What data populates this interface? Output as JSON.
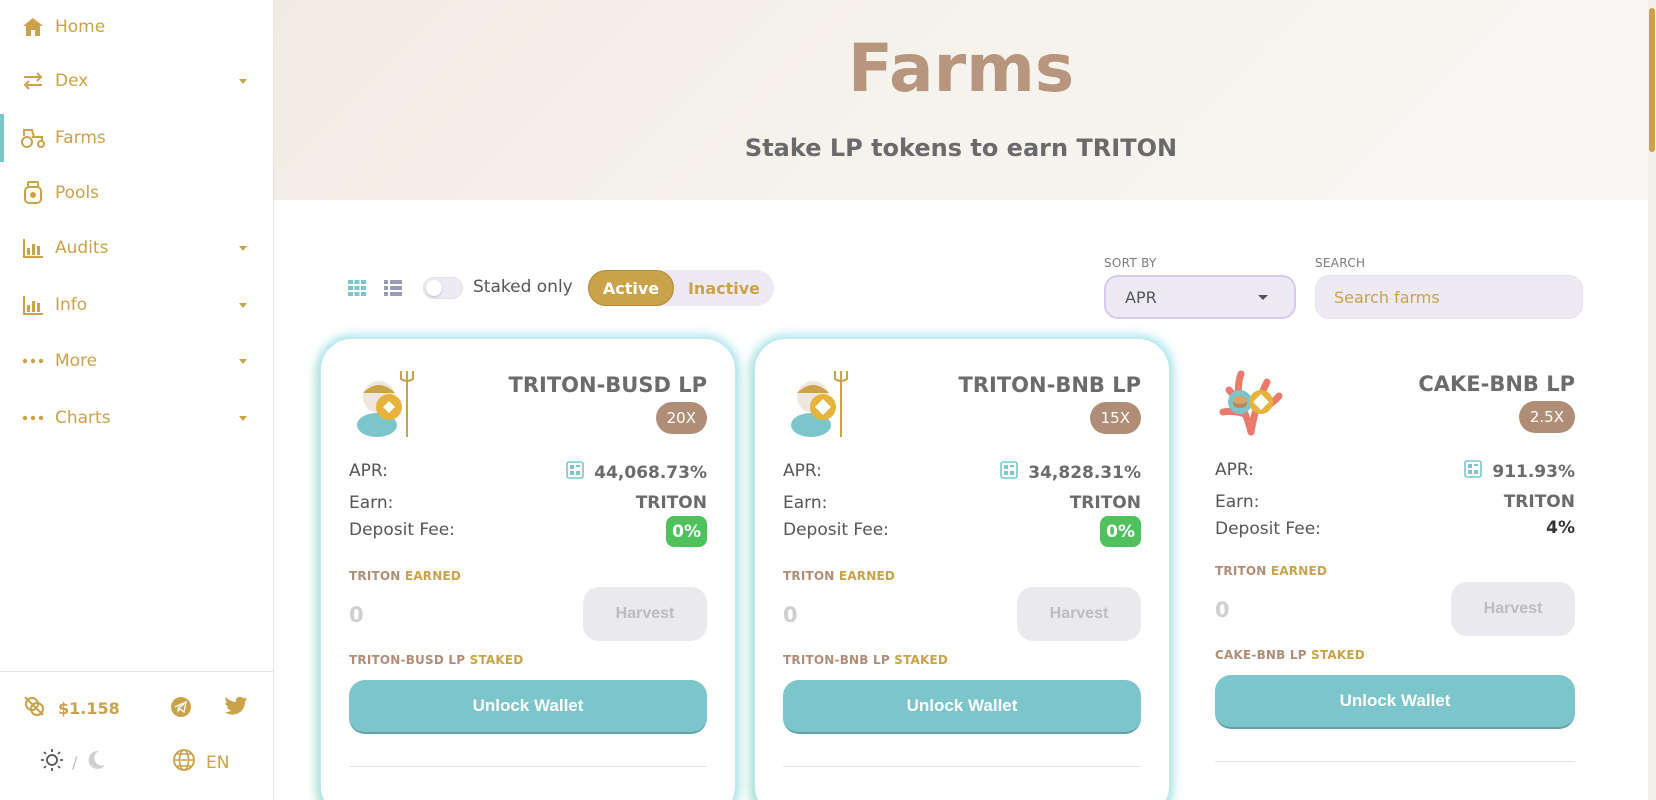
{
  "sidebar": {
    "items": [
      {
        "label": "Home",
        "icon": "home-icon"
      },
      {
        "label": "Dex",
        "icon": "swap-icon"
      },
      {
        "label": "Farms",
        "icon": "tractor-icon"
      },
      {
        "label": "Pools",
        "icon": "pool-jar-icon"
      },
      {
        "label": "Audits",
        "icon": "bar-chart-icon"
      },
      {
        "label": "Info",
        "icon": "bar-chart-icon"
      },
      {
        "label": "More",
        "icon": "dots-icon"
      },
      {
        "label": "Charts",
        "icon": "dots-icon"
      }
    ],
    "price": "$1.158",
    "theme_separator": "/",
    "language": "EN"
  },
  "hero": {
    "title": "Farms",
    "subtitle": "Stake LP tokens to earn TRITON"
  },
  "controls": {
    "staked_only": "Staked only",
    "active": "Active",
    "inactive": "Inactive",
    "sort_label": "SORT BY",
    "sort_value": "APR",
    "search_label": "SEARCH",
    "search_placeholder": "Search farms"
  },
  "farms": [
    {
      "name": "TRITON-BUSD LP",
      "multiplier": "20X",
      "apr_label": "APR:",
      "apr": "44,068.73%",
      "earn_label": "Earn:",
      "earn": "TRITON",
      "fee_label": "Deposit Fee:",
      "fee": "0%",
      "earned_token": "TRITON",
      "earned_word": "EARNED",
      "earned_value": "0",
      "harvest": "Harvest",
      "staked_token": "TRITON-BUSD LP",
      "staked_word": "STAKED",
      "unlock": "Unlock Wallet"
    },
    {
      "name": "TRITON-BNB LP",
      "multiplier": "15X",
      "apr_label": "APR:",
      "apr": "34,828.31%",
      "earn_label": "Earn:",
      "earn": "TRITON",
      "fee_label": "Deposit Fee:",
      "fee": "0%",
      "earned_token": "TRITON",
      "earned_word": "EARNED",
      "earned_value": "0",
      "harvest": "Harvest",
      "staked_token": "TRITON-BNB LP",
      "staked_word": "STAKED",
      "unlock": "Unlock Wallet"
    },
    {
      "name": "CAKE-BNB LP",
      "multiplier": "2.5X",
      "apr_label": "APR:",
      "apr": "911.93%",
      "earn_label": "Earn:",
      "earn": "TRITON",
      "fee_label": "Deposit Fee:",
      "fee": "4%",
      "earned_token": "TRITON",
      "earned_word": "EARNED",
      "earned_value": "0",
      "harvest": "Harvest",
      "staked_token": "CAKE-BNB LP",
      "staked_word": "STAKED",
      "unlock": "Unlock Wallet"
    }
  ],
  "colors": {
    "accent_gold": "#c9a24a",
    "teal": "#7cc5cb",
    "fee_green": "#4fc25d",
    "multiplier_brown": "#b08d76"
  }
}
